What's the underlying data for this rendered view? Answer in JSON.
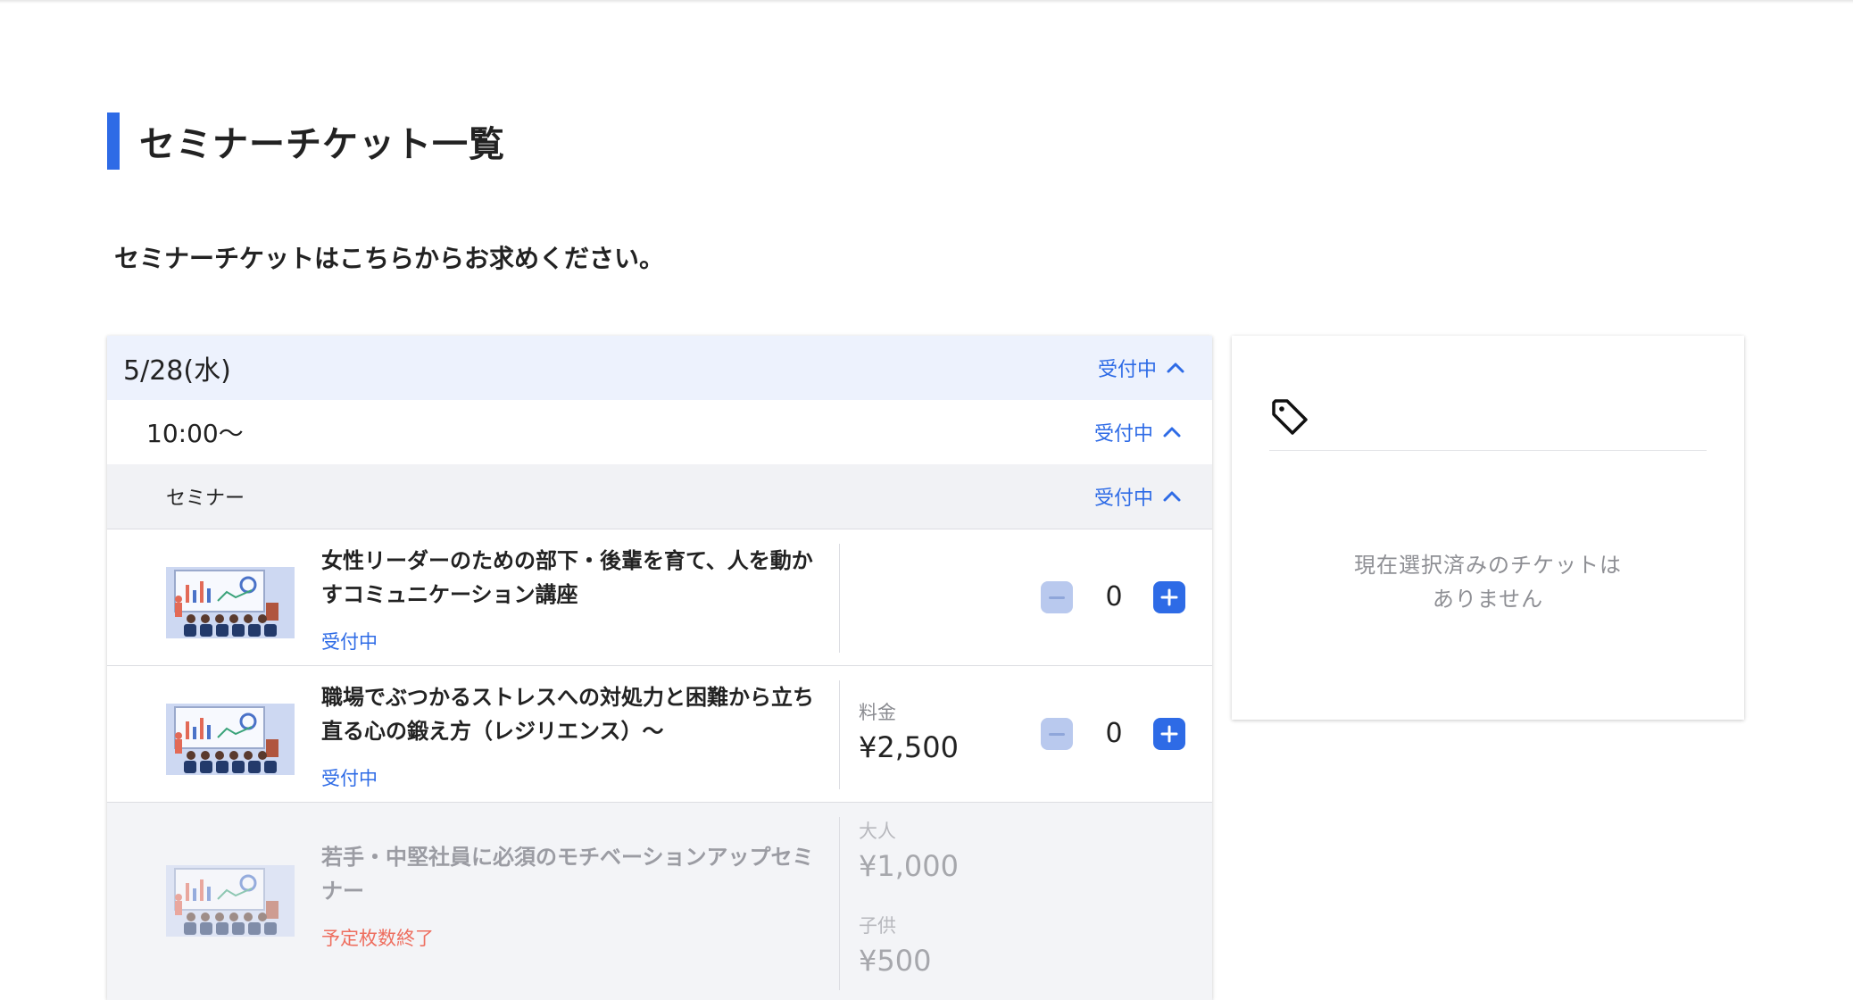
{
  "page": {
    "title": "セミナーチケット一覧",
    "intro": "セミナーチケットはこちらからお求めください。"
  },
  "schedule": {
    "date": "5/28(水)",
    "date_status": "受付中",
    "time": "10:00〜",
    "time_status": "受付中",
    "category": "セミナー",
    "category_status": "受付中"
  },
  "tickets": [
    {
      "title": "女性リーダーのための部下・後輩を育て、人を動かすコミュニケーション講座",
      "status": "受付中",
      "quantity": "0"
    },
    {
      "title": "職場でぶつかるストレスへの対処力と困難から立ち直る心の鍛え方（レジリエンス）〜",
      "status": "受付中",
      "price_label": "料金",
      "price": "¥2,500",
      "quantity": "0"
    },
    {
      "title": "若手・中堅社員に必須のモチベーションアップセミナー",
      "status": "予定枚数終了",
      "prices": [
        {
          "label": "大人",
          "price": "¥1,000"
        },
        {
          "label": "子供",
          "price": "¥500"
        }
      ]
    }
  ],
  "cart": {
    "icon": "tag-icon",
    "empty_line1": "現在選択済みのチケットは",
    "empty_line2": "ありません"
  },
  "colors": {
    "accent": "#2e6be6",
    "ended": "#ee6e5f",
    "date_row_bg": "#edf2fd",
    "category_row_bg": "#f1f2f5"
  }
}
